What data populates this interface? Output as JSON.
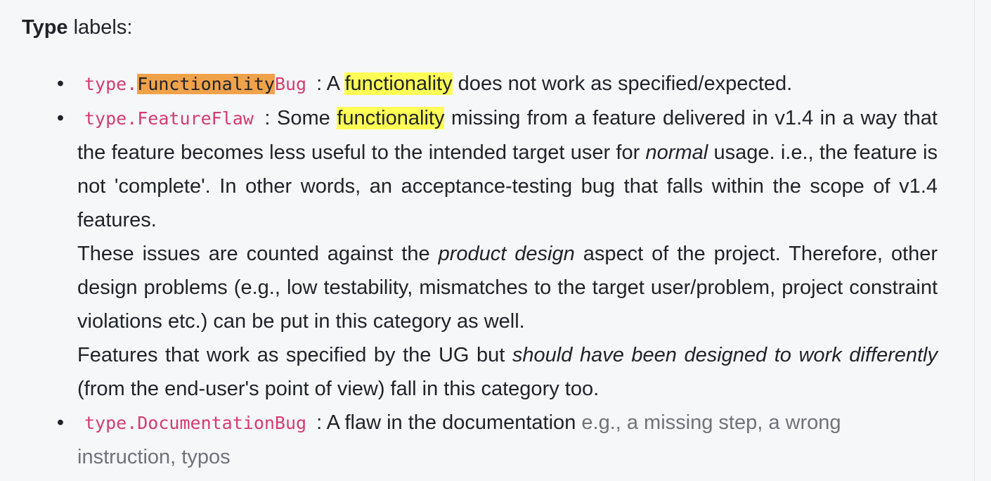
{
  "heading": {
    "bold": "Type",
    "rest": " labels:"
  },
  "items": [
    {
      "label_prefix": "type.",
      "label_highlight": "Functionality",
      "label_suffix": "Bug",
      "t1": " : A ",
      "hl": "functionality",
      "t2": " does not work as specified/expected."
    },
    {
      "label": "type.FeatureFlaw",
      "t1": " : Some ",
      "hl": "functionality",
      "t2": " missing from a feature delivered in v1.4 in a way that the feature becomes less useful to the intended target user for ",
      "em1": "normal",
      "t3": " usage. i.e., the feature is not 'complete'. In other words, an acceptance-testing bug that falls within the scope of v1.4 features.",
      "p2_t1": "These issues are counted against the ",
      "p2_em": "product design",
      "p2_t2": " aspect of the project. Therefore, other design problems (e.g., low testability, mismatches to the target user/problem, project constraint violations etc.) can be put in this category as well.",
      "p3_t1": "Features that work as specified by the UG but ",
      "p3_em1": "should have been designed to work differently",
      "p3_t2": " (from the end-user's point of view) fall in this category too."
    },
    {
      "label": "type.DocumentationBug",
      "t1": " : A flaw in the documentation ",
      "gray": "e.g., a missing step, a wrong instruction, typos"
    }
  ],
  "bullet_symbol": "•"
}
